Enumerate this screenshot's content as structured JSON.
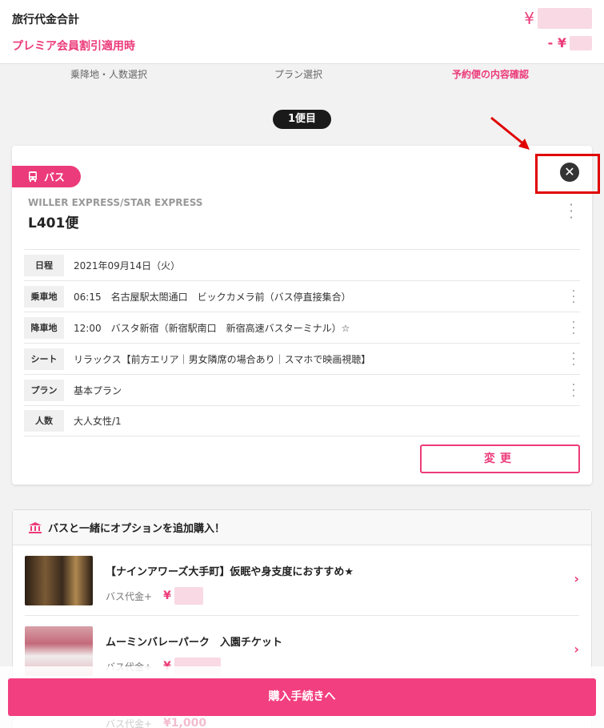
{
  "summary": {
    "total_label": "旅行代金合計",
    "total_currency": "¥",
    "discount_label": "プレミア会員割引適用時",
    "discount_prefix": "- ¥"
  },
  "steps": [
    "乗降地・人数選択",
    "プラン選択",
    "予約便の内容確認"
  ],
  "trip_label": "1便目",
  "card": {
    "tag": "バス",
    "operator": "WILLER EXPRESS/STAR EXPRESS",
    "service": "L401便",
    "rows": [
      {
        "label": "日程",
        "value": "2021年09月14日（火）"
      },
      {
        "label": "乗車地",
        "value": "06:15　名古屋駅太閤通口　ビックカメラ前（バス停直接集合）"
      },
      {
        "label": "降車地",
        "value": "12:00　バスタ新宿（新宿駅南口　新宿高速バスターミナル）☆"
      },
      {
        "label": "シート",
        "value": "リラックス【前方エリア｜男女隣席の場合あり｜スマホで映画視聴】"
      },
      {
        "label": "プラン",
        "value": "基本プラン"
      },
      {
        "label": "人数",
        "value": "大人女性/1"
      }
    ],
    "change_button": "変更"
  },
  "options": {
    "heading": "バスと一緒にオプションを追加購入！",
    "items": [
      {
        "title": "【ナインアワーズ大手町】仮眠や身支度におすすめ★",
        "price_prefix": "バス代金+",
        "currency": "¥"
      },
      {
        "title": "ムーミンバレーパーク　入園チケット",
        "price_prefix": "バス代金+",
        "currency": "¥"
      }
    ],
    "partial_item": {
      "price_prefix": "バス代金+",
      "price": "¥1,000"
    }
  },
  "purchase_button": "購入手続きへ",
  "colors": {
    "accent": "#ec3b7a",
    "highlight": "#e00000"
  }
}
